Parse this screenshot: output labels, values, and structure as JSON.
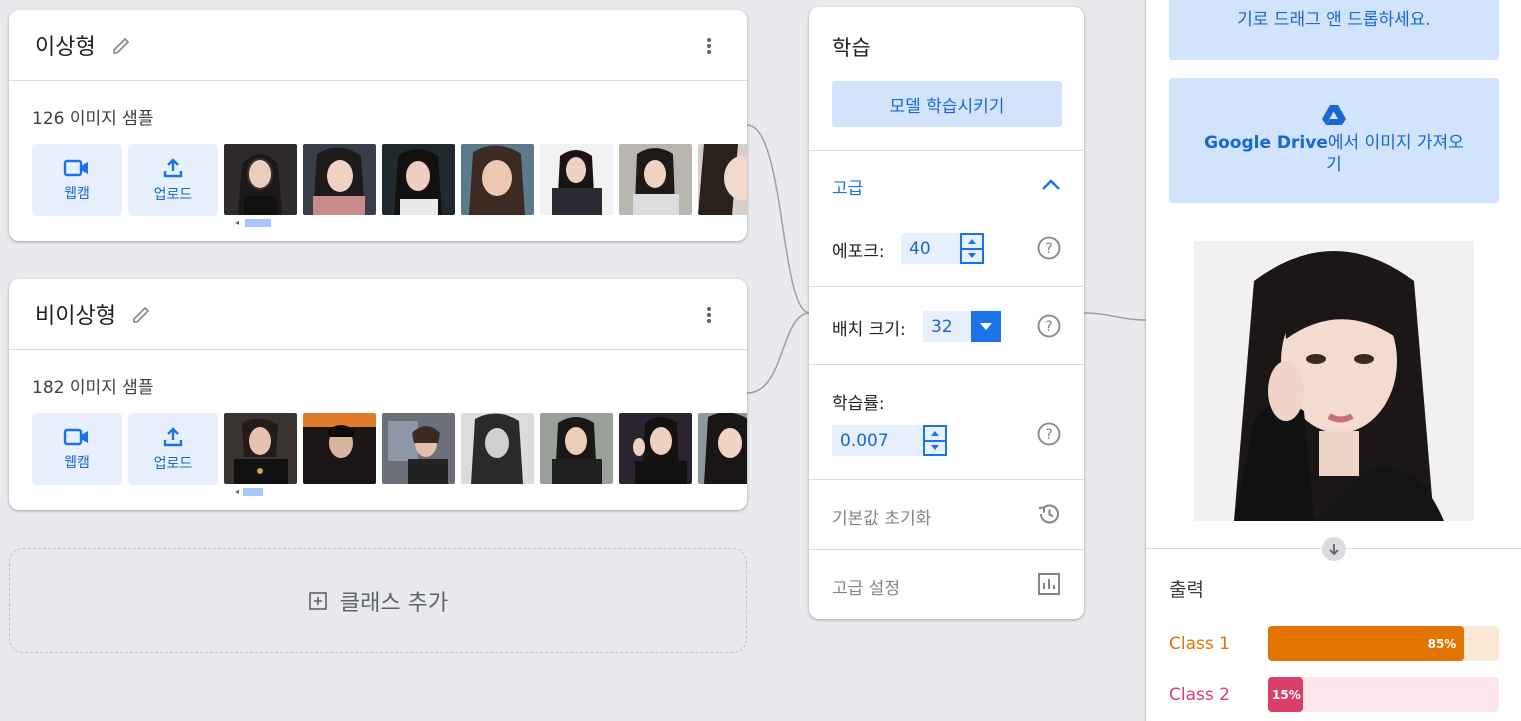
{
  "classes": [
    {
      "name": "이상형",
      "count": "126",
      "samples_label": "이미지 샘플",
      "webcam": "웹캠",
      "upload": "업로드"
    },
    {
      "name": "비이상형",
      "count": "182",
      "samples_label": "이미지 샘플",
      "webcam": "웹캠",
      "upload": "업로드"
    }
  ],
  "add_class": "클래스 추가",
  "training": {
    "title": "학습",
    "train_button": "모델 학습시키기",
    "advanced": "고급",
    "epochs_label": "에포크:",
    "epochs_value": "40",
    "batch_label": "배치 크기:",
    "batch_value": "32",
    "lr_label": "학습률:",
    "lr_value": "0.007",
    "reset": "기본값 초기화",
    "advanced_settings": "고급 설정"
  },
  "preview": {
    "drop_text": "기로 드래그 앤 드롭하세요.",
    "drive_brand": "Google Drive",
    "drive_text": "에서 이미지 가져오기",
    "output_title": "출력",
    "outputs": [
      {
        "label": "Class 1",
        "percent": 85,
        "percent_text": "85%",
        "color": "#e37400",
        "track": "#fce8d6"
      },
      {
        "label": "Class 2",
        "percent": 15,
        "percent_text": "15%",
        "color": "#d93f6a",
        "track": "#fde7ec"
      }
    ]
  },
  "colors": {
    "accent": "#1a73e8",
    "accent_light": "#d2e3fc"
  }
}
